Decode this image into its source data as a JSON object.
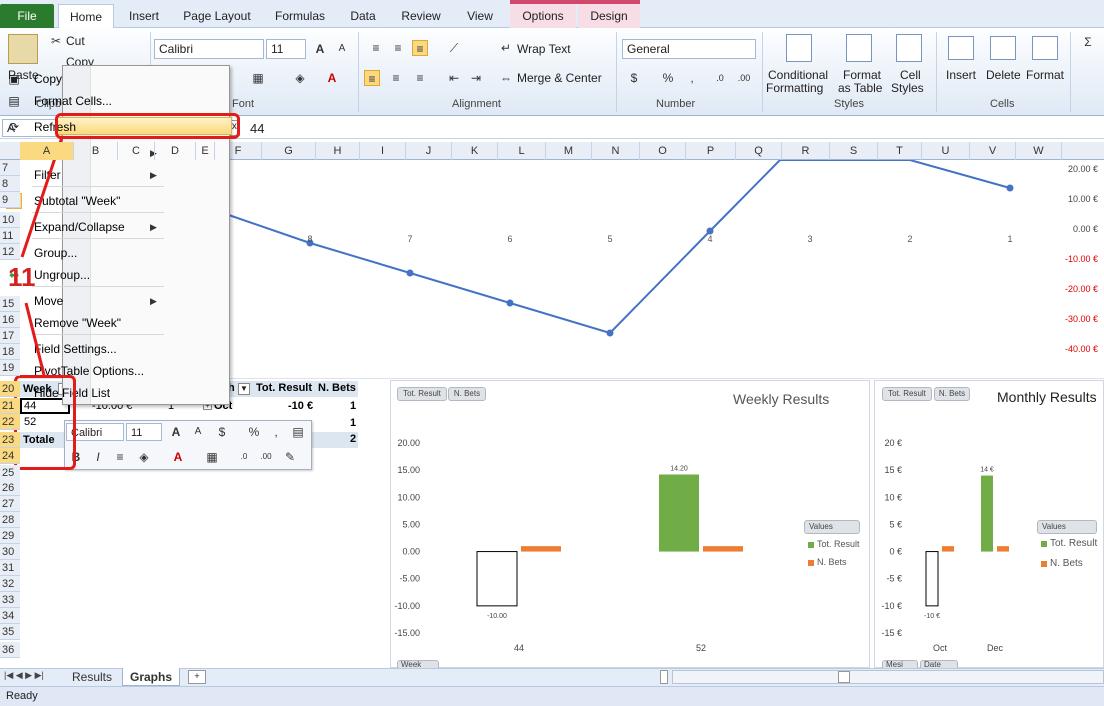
{
  "tabs": {
    "file": "File",
    "home": "Home",
    "insert": "Insert",
    "page_layout": "Page Layout",
    "formulas": "Formulas",
    "data": "Data",
    "review": "Review",
    "view": "View",
    "options": "Options",
    "design": "Design"
  },
  "ribbon": {
    "cut": "Cut",
    "copy": "Copy",
    "paste": "Paste",
    "clipboard": "Clipb",
    "font_name": "Calibri",
    "font_size": "11",
    "font_group": "Font",
    "wrap_text": "Wrap Text",
    "merge_center": "Merge & Center",
    "alignment": "Alignment",
    "number_format": "General",
    "number": "Number",
    "cond_format_1": "Conditional",
    "cond_format_2": "Formatting",
    "format_table_1": "Format",
    "format_table_2": "as Table",
    "cell_styles_1": "Cell",
    "cell_styles_2": "Styles",
    "styles": "Styles",
    "insert": "Insert",
    "delete": "Delete",
    "format": "Format",
    "cells": "Cells"
  },
  "formula_bar": {
    "name_box": "A",
    "value": "44"
  },
  "columns": [
    "A",
    "B",
    "C",
    "D",
    "E",
    "F",
    "G",
    "H",
    "I",
    "J",
    "K",
    "L",
    "M",
    "N",
    "O",
    "P",
    "Q",
    "R",
    "S",
    "T",
    "U",
    "V",
    "W"
  ],
  "rows": [
    "7",
    "8",
    "9",
    "10",
    "11",
    "12",
    "13",
    "14",
    "15",
    "16",
    "17",
    "18",
    "19",
    "20",
    "21",
    "22",
    "23",
    "24",
    "25",
    "26",
    "27",
    "28",
    "29",
    "30",
    "31",
    "32",
    "33",
    "34",
    "35",
    "36"
  ],
  "context_menu": {
    "items": [
      "Copy",
      "Format Cells...",
      "Refresh",
      "Sort",
      "Filter",
      "Subtotal \"Week\"",
      "Expand/Collapse",
      "Group...",
      "Ungroup...",
      "Move",
      "Remove \"Week\"",
      "Field Settings...",
      "PivotTable Options...",
      "Hide Field List"
    ]
  },
  "annotation": {
    "number": "11"
  },
  "pivot1": {
    "header": "Week",
    "rows": [
      "44",
      "52"
    ],
    "total": "Totale",
    "values": [
      "-10.00 €",
      "1"
    ]
  },
  "pivot2": {
    "col_tot": "Tot. Result",
    "col_bets": "N. Bets",
    "h_suffix": "h",
    "rows": [
      {
        "label": "Oct",
        "tot": "-10 €",
        "bets": "1"
      },
      {
        "label": "",
        "tot": "",
        "bets": "1"
      },
      {
        "label": "",
        "tot": "",
        "bets": "2"
      }
    ]
  },
  "mini_toolbar": {
    "font": "Calibri",
    "size": "11"
  },
  "line_chart": {
    "x_labels": [
      "8",
      "7",
      "6",
      "5",
      "4",
      "3",
      "2",
      "1"
    ],
    "y_labels": [
      "20.00 €",
      "10.00 €",
      "0.00 €",
      "-10.00 €",
      "-20.00 €",
      "-30.00 €",
      "-40.00 €"
    ]
  },
  "chart_data": [
    {
      "type": "bar",
      "title": "Weekly Results",
      "categories": [
        "44",
        "52"
      ],
      "series": [
        {
          "name": "Tot. Result",
          "values": [
            -10.0,
            14.2
          ]
        },
        {
          "name": "N. Bets",
          "values": [
            1,
            1
          ]
        }
      ],
      "ylim": [
        -15,
        20
      ],
      "y_ticks": [
        "20.00",
        "15.00",
        "10.00",
        "5.00",
        "0.00",
        "-5.00",
        "-10.00",
        "-15.00"
      ],
      "data_labels": [
        "-10.00",
        "14.20"
      ],
      "legend_title": "Values",
      "buttons": [
        "Tot. Result",
        "N. Bets"
      ],
      "axis_button": "Week"
    },
    {
      "type": "bar",
      "title": "Monthly Results",
      "categories": [
        "Oct",
        "Dec"
      ],
      "series": [
        {
          "name": "Tot. Result",
          "values": [
            -10,
            14
          ]
        },
        {
          "name": "N. Bets",
          "values": [
            1,
            1
          ]
        }
      ],
      "ylim": [
        -15,
        20
      ],
      "y_ticks": [
        "20 €",
        "15 €",
        "10 €",
        "5 €",
        "0 €",
        "-5 €",
        "-10 €",
        "-15 €"
      ],
      "data_labels": [
        "-10 €",
        "14 €"
      ],
      "legend_title": "Values",
      "buttons": [
        "Tot. Result",
        "N. Bets"
      ],
      "axis_buttons": [
        "Mesi",
        "Date"
      ]
    }
  ],
  "sheets": {
    "results": "Results",
    "graphs": "Graphs"
  },
  "status": {
    "ready": "Ready"
  }
}
